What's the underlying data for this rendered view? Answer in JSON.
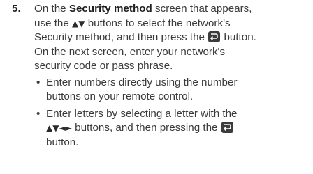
{
  "step": {
    "number": "5.",
    "line1_pre": "On the ",
    "screen_name": "Security method",
    "line1_post": " screen that appears,",
    "line2_pre": "use the ",
    "updown_arrows": "▲▼",
    "line2_post": " buttons to select the network's",
    "line3_pre": "Security method, and then press the ",
    "line3_post": " button.",
    "line4": "On the next screen, enter your network's",
    "line5": "security code or pass phrase."
  },
  "bullets": {
    "bullet_glyph": "•",
    "item1_line1": "Enter numbers directly using the number",
    "item1_line2": "buttons on your remote control.",
    "item2_line1": "Enter letters by selecting a letter with the",
    "item2_arrows": "▲▼◄►",
    "item2_mid": " buttons, and then pressing the ",
    "item2_line3": "button."
  },
  "icons": {
    "enter_button": "enter-button-icon"
  },
  "colors": {
    "text": "#3a3a3a",
    "bold_text": "#1f1f1f",
    "icon_bg": "#3c3c3c"
  }
}
